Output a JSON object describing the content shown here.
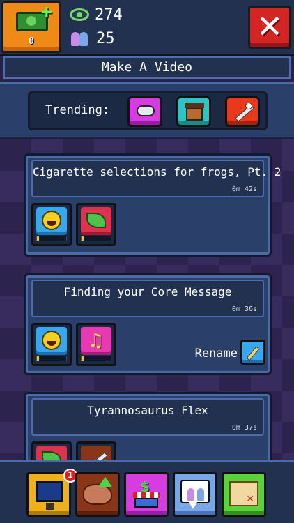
{
  "header": {
    "money": "0",
    "views": "274",
    "subscribers": "25",
    "close_label": "✕"
  },
  "page": {
    "title": "Make A Video"
  },
  "trending": {
    "label": "Trending:",
    "categories": [
      "gaming",
      "house",
      "sports"
    ]
  },
  "videos": [
    {
      "title": "Cigarette selections for frogs, Pt. 2",
      "duration": "0m 42s",
      "categories": [
        "comedy",
        "nature"
      ]
    },
    {
      "title": "Finding your Core Message",
      "duration": "0m 36s",
      "categories": [
        "comedy",
        "music"
      ],
      "rename_label": "Rename"
    },
    {
      "title": "Tyrannosaurus Flex",
      "duration": "0m 37s",
      "categories": [
        "nature",
        "sports"
      ]
    }
  ],
  "bottom_nav": {
    "badge_count": "1",
    "items": [
      "computer-icon",
      "brain-upgrade-icon",
      "shop-icon",
      "chat-icon",
      "map-icon"
    ]
  },
  "colors": {
    "panel": "#22314f",
    "accent_orange": "#f08a16",
    "close_red": "#d42424",
    "border_blue": "#4c6db0"
  }
}
